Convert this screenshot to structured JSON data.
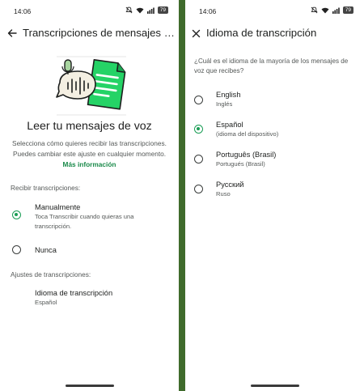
{
  "left": {
    "status": {
      "time": "14:06",
      "battery": "79"
    },
    "appbar": {
      "back_icon": "arrow-back-icon",
      "title": "Transcripciones de mensajes de voz"
    },
    "headline": "Leer tu mensajes de voz",
    "description": "Selecciona cómo quieres recibir las transcripciones. Puedes cambiar este ajuste en cualquier momento.",
    "more_link": "Más información",
    "receive_section": "Recibir transcripciones:",
    "options": [
      {
        "title": "Manualmente",
        "subtitle": "Toca Transcribir cuando quieras una transcripción.",
        "selected": true
      },
      {
        "title": "Nunca",
        "subtitle": "",
        "selected": false
      }
    ],
    "settings_section": "Ajustes de transcripciones:",
    "language_setting": {
      "title": "Idioma de transcripción",
      "value": "Español"
    }
  },
  "right": {
    "status": {
      "time": "14:06",
      "battery": "79"
    },
    "appbar": {
      "close_icon": "close-icon",
      "title": "Idioma de transcripción"
    },
    "question": "¿Cuál es el idioma de la mayoría de los mensajes de voz que recibes?",
    "languages": [
      {
        "name": "English",
        "sub": "Inglés",
        "selected": false
      },
      {
        "name": "Español",
        "sub": "(idioma del dispositivo)",
        "selected": true
      },
      {
        "name": "Português (Brasil)",
        "sub": "Portugués (Brasil)",
        "selected": false
      },
      {
        "name": "Русский",
        "sub": "Ruso",
        "selected": false
      }
    ]
  },
  "colors": {
    "accent": "#1a9d55",
    "link": "#1a8a4a",
    "divider": "#3f6b2c"
  }
}
